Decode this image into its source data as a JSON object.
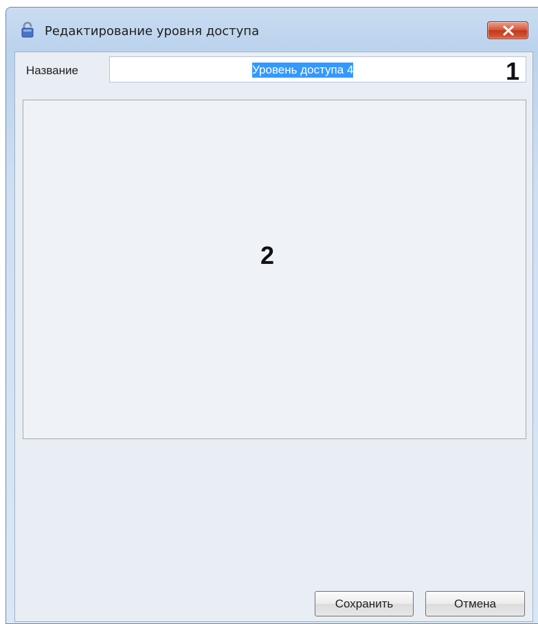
{
  "window": {
    "title": "Редактирование уровня доступа",
    "icon": "lock-icon",
    "close_icon": "close-icon"
  },
  "form": {
    "name_label": "Название",
    "name_value": "Уровень доступа 4"
  },
  "callouts": {
    "one": "1",
    "two": "2"
  },
  "buttons": {
    "save": "Сохранить",
    "cancel": "Отмена"
  },
  "colors": {
    "close_button": "#c4371b",
    "selection": "#3399ff",
    "lock_icon": "#4a72c8"
  }
}
